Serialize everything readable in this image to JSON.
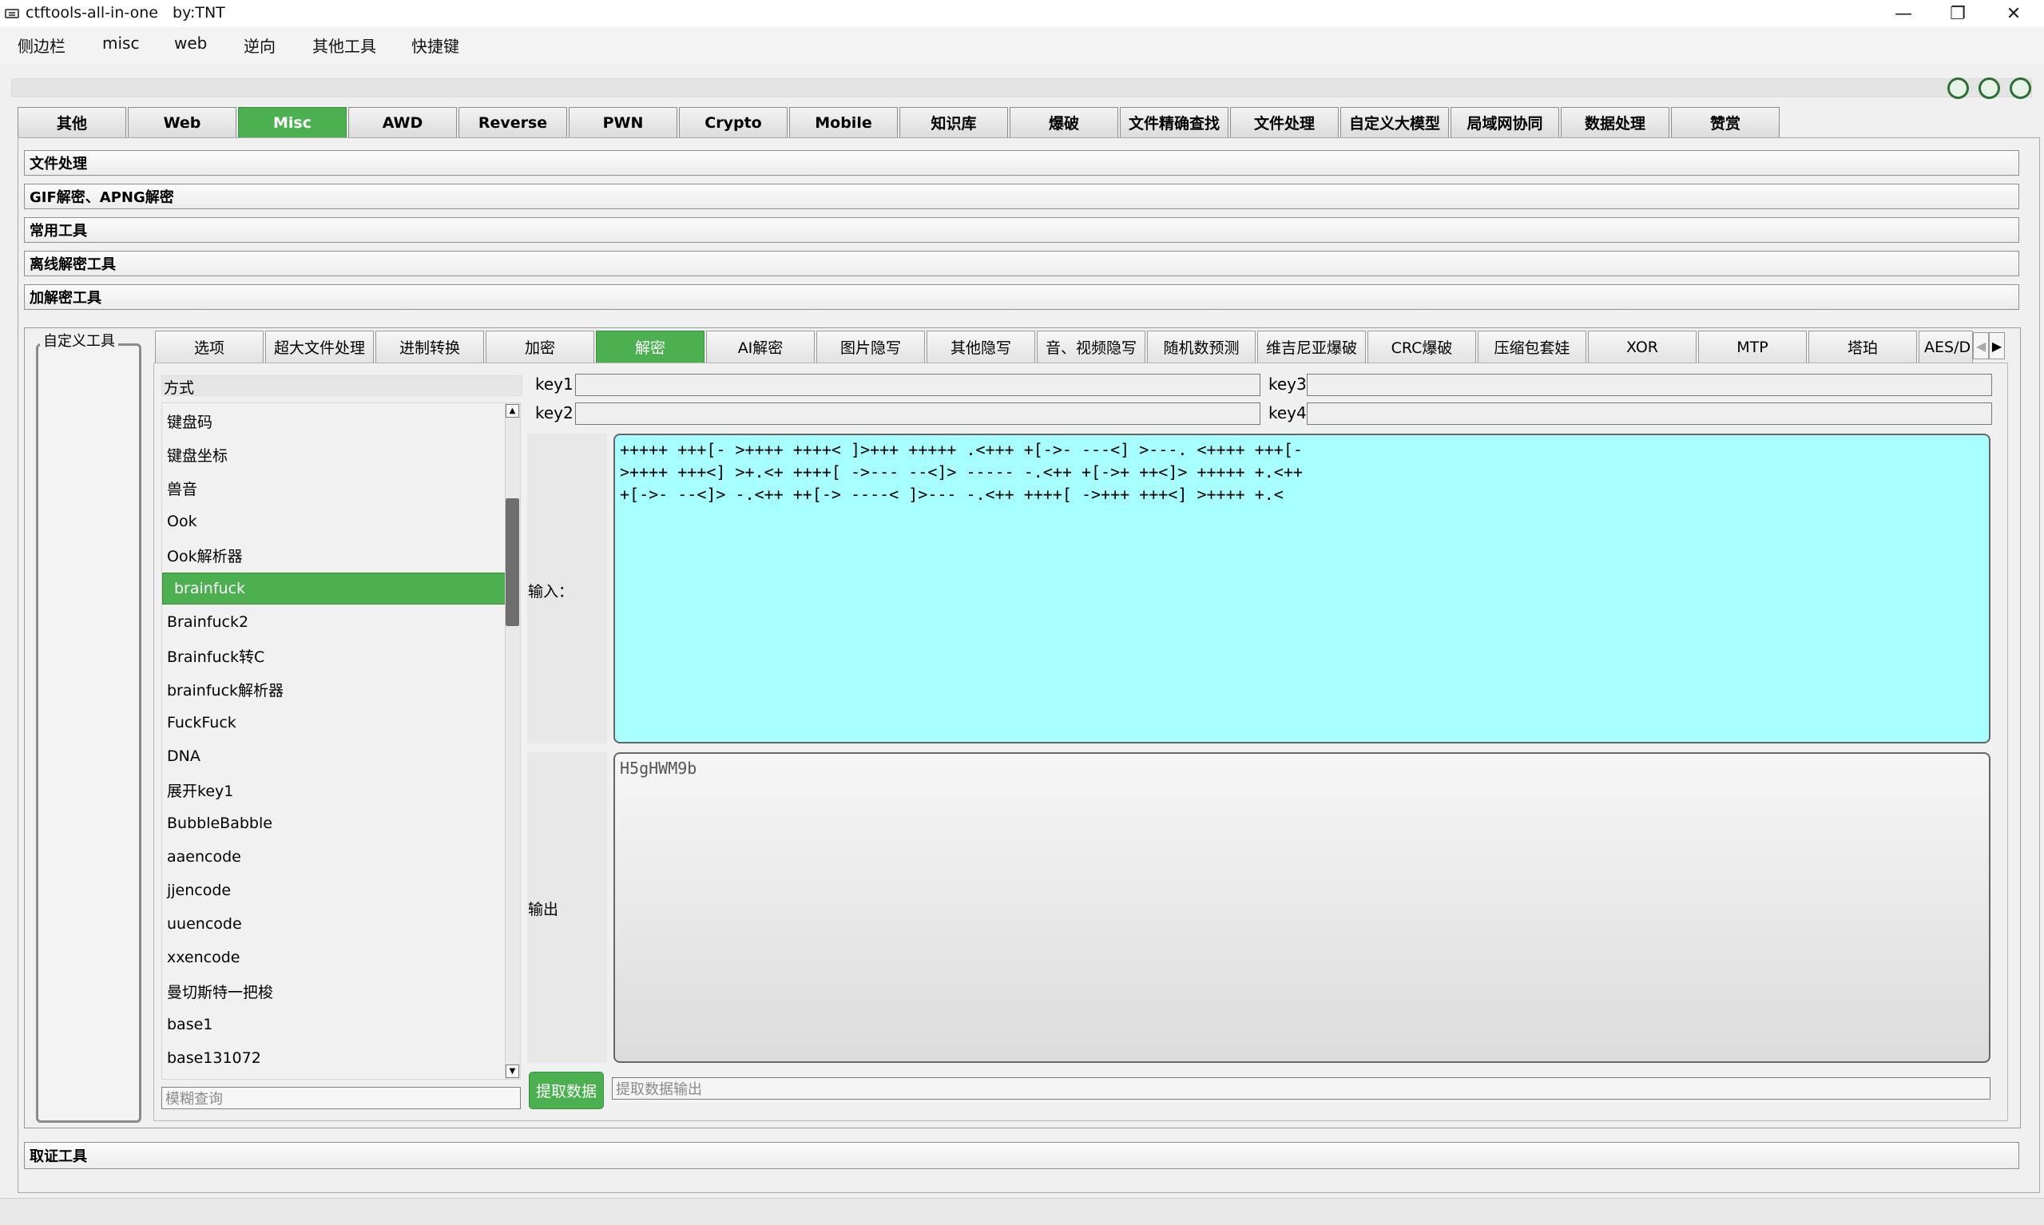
{
  "window": {
    "title": "ctftools-all-in-one   by:TNT",
    "minimize": "—",
    "maximize": "❐",
    "close": "✕"
  },
  "menu": [
    "侧边栏",
    "misc",
    "web",
    "逆向",
    "其他工具",
    "快捷键"
  ],
  "top_tabs": [
    "其他",
    "Web",
    "Misc",
    "AWD",
    "Reverse",
    "PWN",
    "Crypto",
    "Mobile",
    "知识库",
    "爆破",
    "文件精确查找",
    "文件处理",
    "自定义大模型",
    "局域网协同",
    "数据处理",
    "赞赏"
  ],
  "active_top_tab": "Misc",
  "sections": [
    "文件处理",
    "GIF解密、APNG解密",
    "常用工具",
    "离线解密工具",
    "加解密工具"
  ],
  "custom_tools_label": "自定义工具",
  "sub_tabs": [
    "选项",
    "超大文件处理",
    "进制转换",
    "加密",
    "解密",
    "AI解密",
    "图片隐写",
    "其他隐写",
    "音、视频隐写",
    "随机数预测",
    "维吉尼亚爆破",
    "CRC爆破",
    "压缩包套娃",
    "XOR",
    "MTP",
    "塔珀",
    "AES/D"
  ],
  "active_sub_tab": "解密",
  "method_header": "方式",
  "methods": [
    "键盘码",
    "键盘坐标",
    "兽音",
    "Ook",
    "Ook解析器",
    "brainfuck",
    "Brainfuck2",
    "Brainfuck转C",
    "brainfuck解析器",
    "FuckFuck",
    "DNA",
    "展开key1",
    "BubbleBabble",
    "aaencode",
    "jjencode",
    "uuencode",
    "xxencode",
    "曼切斯特一把梭",
    "base1",
    "base131072"
  ],
  "selected_method": "brainfuck",
  "search_placeholder": "模糊查询",
  "keys": {
    "key1": "key1",
    "key2": "key2",
    "key3": "key3",
    "key4": "key4"
  },
  "input_label": "输入：",
  "output_label": "输出",
  "input_text": "+++++ +++[- >++++ ++++< ]>+++ +++++ .<+++ +[->- ---<] >---. <++++ +++[-\n>++++ +++<] >+.<+ ++++[ ->--- --<]> ----- -.<++ +[->+ ++<]> +++++ +.<++\n+[->- --<]> -.<++ ++[-> ----< ]>--- -.<++ ++++[ ->+++ +++<] >++++ +.<",
  "output_text": "H5gHWM9b",
  "extract_button": "提取数据",
  "extract_placeholder": "提取数据输出",
  "forensics_section": "取证工具",
  "colors": {
    "accent_green": "#4caf50",
    "input_bg": "#a8ffff"
  }
}
